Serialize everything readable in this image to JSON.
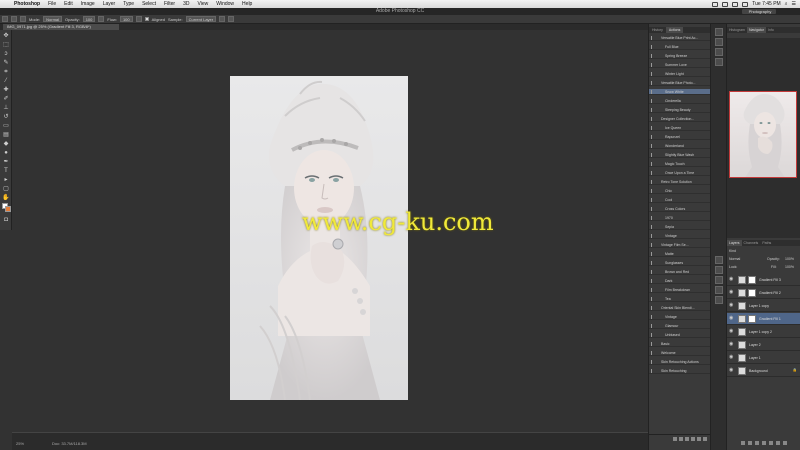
{
  "menubar": {
    "items": [
      "Photoshop",
      "File",
      "Edit",
      "Image",
      "Layer",
      "Type",
      "Select",
      "Filter",
      "3D",
      "View",
      "Window",
      "Help"
    ],
    "clock": "Tue 7:45 PM"
  },
  "titlebar": {
    "title": "Adobe Photoshop CC",
    "workspace": "Photography"
  },
  "options": {
    "mode_label": "Mode:",
    "mode_value": "Normal",
    "opacity_label": "Opacity:",
    "opacity_value": "100",
    "flow_label": "Flow:",
    "flow_value": "100",
    "aligned_label": "Aligned",
    "sample_label": "Sample:",
    "sample_value": "Current Layer"
  },
  "document": {
    "tab": "IMG_0971.jpg @ 25% (Gradient Fill 3, RGB/8*)"
  },
  "canvas": {
    "watermark": "www.cg-ku.com"
  },
  "status": {
    "zoom": "25%",
    "doc_size": "Doc: 33.7M/118.3M"
  },
  "actions_panel": {
    "tabs": [
      "History",
      "Actions"
    ],
    "rows": [
      {
        "label": "Versatile Blue Print Ac...",
        "type": "set"
      },
      {
        "label": "Full Blue",
        "type": "action"
      },
      {
        "label": "Spring Breeze",
        "type": "action"
      },
      {
        "label": "Summer Love",
        "type": "action"
      },
      {
        "label": "Winter Light",
        "type": "action"
      },
      {
        "label": "Versatile Blue Photo...",
        "type": "set"
      },
      {
        "label": "Snow White",
        "type": "action",
        "selected": true
      },
      {
        "label": "Cinderella",
        "type": "action"
      },
      {
        "label": "Sleeping Beauty",
        "type": "action"
      },
      {
        "label": "Designer Collection...",
        "type": "set"
      },
      {
        "label": "Ice Queen",
        "type": "action"
      },
      {
        "label": "Rapunzel",
        "type": "action"
      },
      {
        "label": "Wonderland",
        "type": "action"
      },
      {
        "label": "Slightly Blue Wash",
        "type": "action"
      },
      {
        "label": "Magic Touch",
        "type": "action"
      },
      {
        "label": "Once Upon a Time",
        "type": "action"
      },
      {
        "label": "Retro Tone Solution",
        "type": "set"
      },
      {
        "label": "Chic",
        "type": "action"
      },
      {
        "label": "Cool",
        "type": "action"
      },
      {
        "label": "Cross Colors",
        "type": "action"
      },
      {
        "label": "1970",
        "type": "action"
      },
      {
        "label": "Sepia",
        "type": "action"
      },
      {
        "label": "Vintage",
        "type": "action"
      },
      {
        "label": "Vintage Film Se...",
        "type": "set"
      },
      {
        "label": "Matte",
        "type": "action"
      },
      {
        "label": "Sunglasses",
        "type": "action"
      },
      {
        "label": "Brown and Red",
        "type": "action"
      },
      {
        "label": "Dark",
        "type": "action"
      },
      {
        "label": "Film Breakdown",
        "type": "action"
      },
      {
        "label": "Tea",
        "type": "action"
      },
      {
        "label": "Oriental Skin Blendi...",
        "type": "set"
      },
      {
        "label": "Vintage",
        "type": "action"
      },
      {
        "label": "Glamour",
        "type": "action"
      },
      {
        "label": "Unbiased",
        "type": "action"
      },
      {
        "label": "Basic",
        "type": "set"
      },
      {
        "label": "Welcome",
        "type": "set"
      },
      {
        "label": "Skin Retouching Actions",
        "type": "set"
      },
      {
        "label": "Skin Retouching",
        "type": "set"
      }
    ]
  },
  "dock": {
    "nav_tabs": [
      "Histogram",
      "Navigator",
      "Info"
    ],
    "layer_tabs": [
      "Layers",
      "Channels",
      "Paths"
    ],
    "kind_label": "Kind",
    "blend_mode": "Normal",
    "opacity_label": "Opacity:",
    "opacity_value": "100%",
    "lock_label": "Lock:",
    "fill_label": "Fill:",
    "fill_value": "100%",
    "layers": [
      {
        "name": "Gradient Fill 3",
        "mask": true
      },
      {
        "name": "Gradient Fill 2",
        "mask": true
      },
      {
        "name": "Layer 1 copy",
        "mask": false
      },
      {
        "name": "Gradient Fill 1",
        "mask": true,
        "selected": true
      },
      {
        "name": "Layer 1 copy 2",
        "mask": false
      },
      {
        "name": "Layer 2",
        "mask": false
      },
      {
        "name": "Layer 1",
        "mask": false
      },
      {
        "name": "Background",
        "mask": false,
        "locked": true
      }
    ]
  },
  "colors": {
    "foreground": "#ffffff",
    "background": "#e07b39",
    "selection": "#4f6689"
  }
}
